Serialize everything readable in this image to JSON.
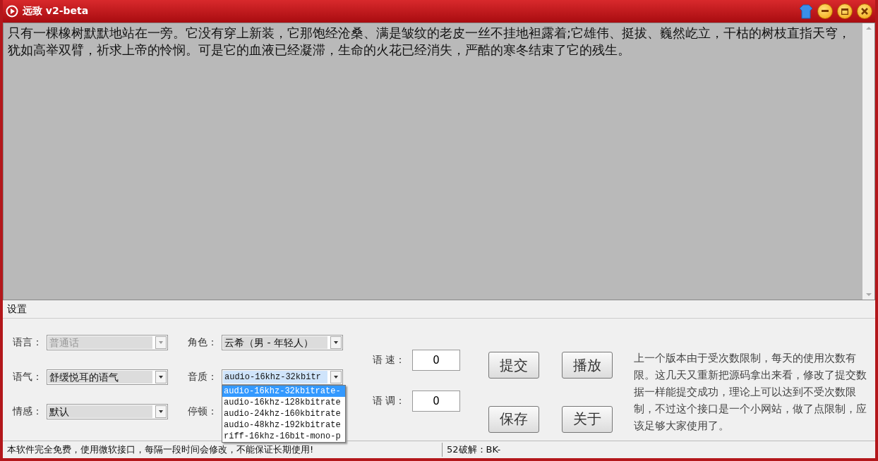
{
  "window": {
    "title": "远致 v2-beta"
  },
  "text_area": {
    "value": "只有一棵橡树默默地站在一旁。它没有穿上新装，它那饱经沧桑、满是皱纹的老皮一丝不挂地袒露着;它雄伟、挺拔、巍然屹立，干枯的树枝直指天穹，犹如高举双臂，祈求上帝的怜悯。可是它的血液已经凝滞，生命的火花已经消失，严酷的寒冬结束了它的残生。"
  },
  "settings": {
    "title": "设置",
    "combos": [
      {
        "label": "语言：",
        "value": "普通话",
        "disabled": true,
        "expanded": false
      },
      {
        "label": "语气：",
        "value": "舒缓悦耳的语气",
        "disabled": false,
        "expanded": false
      },
      {
        "label": "情感：",
        "value": "默认",
        "disabled": false,
        "expanded": false
      },
      {
        "label": "角色：",
        "value": "云希（男 - 年轻人）",
        "disabled": false,
        "expanded": false
      },
      {
        "label": "音质：",
        "value": "audio-16khz-32kbitr",
        "disabled": false,
        "expanded": true,
        "options": [
          {
            "label": "audio-16khz-32kbitrate-",
            "selected": true
          },
          {
            "label": "audio-16khz-128kbitrate",
            "selected": false
          },
          {
            "label": "audio-24khz-160kbitrate",
            "selected": false
          },
          {
            "label": "audio-48khz-192kbitrate",
            "selected": false
          },
          {
            "label": "riff-16khz-16bit-mono-p",
            "selected": false
          }
        ]
      },
      {
        "label": "停顿："
      }
    ],
    "fields": [
      {
        "label": "语 速：",
        "value": "0"
      },
      {
        "label": "语 调：",
        "value": "0"
      }
    ],
    "buttons": [
      "提交",
      "播放",
      "保存",
      "关于"
    ],
    "note": "上一个版本由于受次数限制，每天的使用次数有限。这几天又重新把源码拿出来看，修改了提交数据一样能提交成功，理论上可以达到不受次数限制，不过这个接口是一个小网站，做了点限制，应该足够大家使用了。"
  },
  "status_bar": [
    "本软件完全免费，使用微软接口，每隔一段时间会修改，不能保证长期使用!",
    "52破解：BK-"
  ]
}
